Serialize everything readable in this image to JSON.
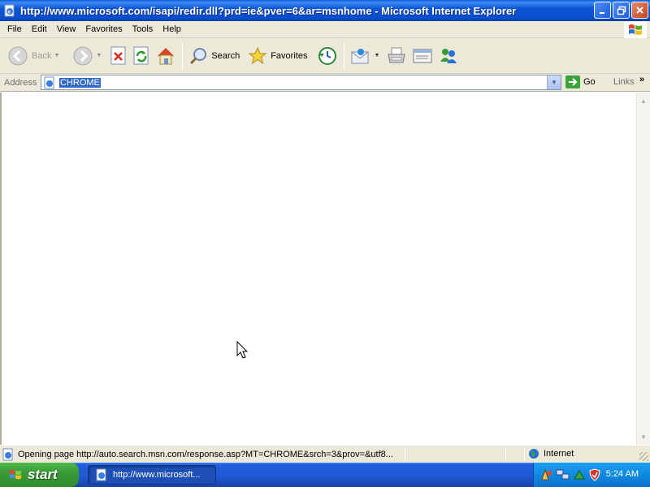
{
  "window": {
    "title": "http://www.microsoft.com/isapi/redir.dll?prd=ie&pver=6&ar=msnhome - Microsoft Internet Explorer",
    "minimize_icon": "minimize-icon",
    "maximize_icon": "restore-icon",
    "close_icon": "close-icon"
  },
  "menubar": {
    "items": [
      "File",
      "Edit",
      "View",
      "Favorites",
      "Tools",
      "Help"
    ]
  },
  "toolbar": {
    "back": "Back",
    "search": "Search",
    "favorites": "Favorites"
  },
  "address": {
    "label": "Address",
    "value": "CHROME",
    "go": "Go",
    "links": "Links"
  },
  "status": {
    "text": "Opening page http://auto.search.msn.com/response.asp?MT=CHROME&srch=3&prov=&utf8...",
    "zone": "Internet"
  },
  "taskbar": {
    "start": "start",
    "task": "http://www.microsoft...",
    "clock": "5:24 AM"
  },
  "colors": {
    "titlebar": "#0a4fcd",
    "chrome": "#ece9d8",
    "selection": "#316ac5",
    "start_green": "#3a9b38",
    "taskbar_blue": "#245edb"
  }
}
